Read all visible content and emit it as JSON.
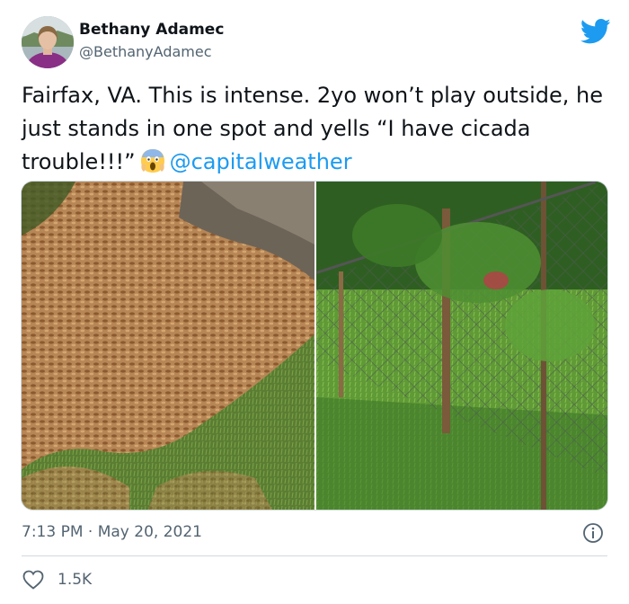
{
  "author": {
    "name": "Bethany Adamec",
    "handle": "@BethanyAdamec"
  },
  "tweet": {
    "text_before": "Fairfax, VA. This is intense. 2yo won’t play outside, he just stands in one spot and yells “I have cicada trouble!!!”",
    "emoji": "😱",
    "mention": "@capitalweather"
  },
  "meta": {
    "time": "7:13 PM",
    "separator": " · ",
    "date": "May 20, 2021"
  },
  "engagement": {
    "likes": "1.5K"
  },
  "icons": {
    "brand": "twitter-bird-icon",
    "info": "info-icon",
    "like": "heart-icon",
    "emoji": "screaming-face-emoji"
  },
  "colors": {
    "accent": "#1d9bf0",
    "text": "#0f1419",
    "muted": "#536471",
    "border": "#cfd9de"
  }
}
